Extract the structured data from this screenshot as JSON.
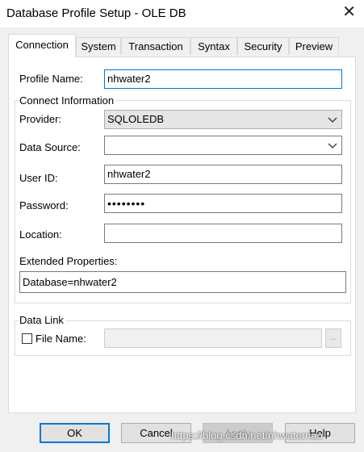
{
  "window": {
    "title": "Database Profile Setup - OLE DB"
  },
  "tabs": [
    {
      "label": "Connection",
      "active": true
    },
    {
      "label": "System",
      "active": false
    },
    {
      "label": "Transaction",
      "active": false
    },
    {
      "label": "Syntax",
      "active": false
    },
    {
      "label": "Security",
      "active": false
    },
    {
      "label": "Preview",
      "active": false
    }
  ],
  "form": {
    "profile_name_label": "Profile Name:",
    "profile_name_value": "nhwater2",
    "connect_group_label": "Connect Information",
    "provider_label": "Provider:",
    "provider_value": "SQLOLEDB",
    "data_source_label": "Data Source:",
    "data_source_value": "",
    "user_id_label": "User ID:",
    "user_id_value": "nhwater2",
    "password_label": "Password:",
    "password_value": "••••••••",
    "location_label": "Location:",
    "location_value": "",
    "extended_label": "Extended Properties:",
    "extended_value": "Database=nhwater2",
    "datalink_group_label": "Data Link",
    "file_name_label": "File Name:",
    "browse_label": "..."
  },
  "buttons": {
    "ok": "OK",
    "cancel": "Cancel",
    "apply": "Apply",
    "help": "Help"
  },
  "watermark": "https://blog.csdn.net/nhwaterriao"
}
